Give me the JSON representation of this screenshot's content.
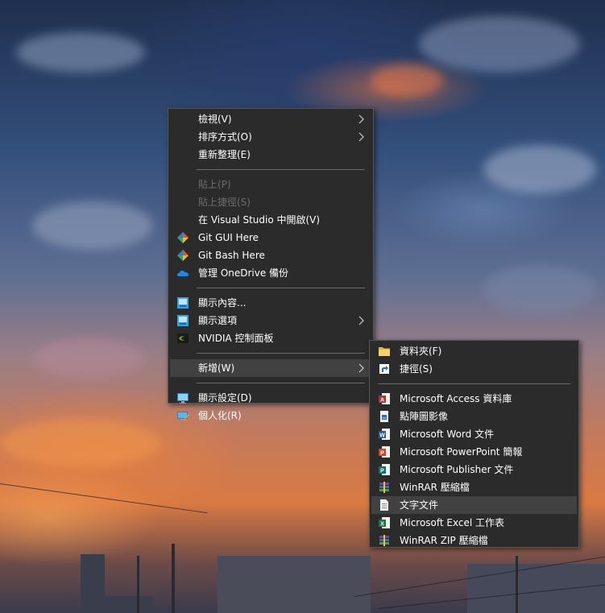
{
  "colors": {
    "menu_bg": "#2b2b2b",
    "menu_border": "#575757",
    "menu_text": "#ffffff",
    "disabled_text": "#6d6d6d",
    "highlight_bg": "#414141"
  },
  "context_menu": {
    "items": [
      {
        "label": "檢視(V)",
        "submenu": true
      },
      {
        "label": "排序方式(O)",
        "submenu": true
      },
      {
        "label": "重新整理(E)"
      },
      {
        "label": "貼上(P)",
        "disabled": true
      },
      {
        "label": "貼上捷徑(S)",
        "disabled": true
      },
      {
        "label": "在 Visual Studio 中開啟(V)"
      },
      {
        "label": "Git GUI Here",
        "icon": "git-icon"
      },
      {
        "label": "Git Bash Here",
        "icon": "git-icon"
      },
      {
        "label": "管理 OneDrive 備份",
        "icon": "onedrive-cloud-icon"
      },
      {
        "label": "顯示內容...",
        "icon": "intel-graphics-icon"
      },
      {
        "label": "顯示選項",
        "icon": "intel-graphics-icon",
        "submenu": true
      },
      {
        "label": "NVIDIA 控制面板",
        "icon": "nvidia-icon"
      },
      {
        "label": "新增(W)",
        "submenu": true,
        "highlighted": true
      },
      {
        "label": "顯示設定(D)",
        "icon": "display-settings-icon"
      },
      {
        "label": "個人化(R)",
        "icon": "personalize-icon"
      }
    ]
  },
  "new_submenu": {
    "items": [
      {
        "label": "資料夾(F)",
        "icon": "folder-icon"
      },
      {
        "label": "捷徑(S)",
        "icon": "shortcut-icon"
      },
      {
        "label": "Microsoft Access 資料庫",
        "icon": "access-icon"
      },
      {
        "label": "點陣圖影像",
        "icon": "bitmap-icon"
      },
      {
        "label": "Microsoft Word 文件",
        "icon": "word-icon"
      },
      {
        "label": "Microsoft PowerPoint 簡報",
        "icon": "powerpoint-icon"
      },
      {
        "label": "Microsoft Publisher 文件",
        "icon": "publisher-icon"
      },
      {
        "label": "WinRAR 壓縮檔",
        "icon": "winrar-icon"
      },
      {
        "label": "文字文件",
        "icon": "text-document-icon",
        "highlighted": true
      },
      {
        "label": "Microsoft Excel 工作表",
        "icon": "excel-icon"
      },
      {
        "label": "WinRAR ZIP 壓縮檔",
        "icon": "winrar-zip-icon"
      }
    ]
  }
}
